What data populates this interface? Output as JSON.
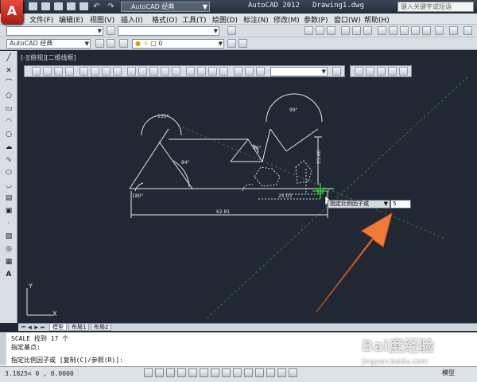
{
  "titlebar": {
    "logo": "A",
    "workspace": "AutoCAD 经典",
    "app_title": "AutoCAD 2012",
    "doc_title": "Drawing1.dwg",
    "search_placeholder": "键入关键字或短语"
  },
  "menu": [
    "文件(F)",
    "编辑(E)",
    "视图(V)",
    "插入(I)",
    "格式(O)",
    "工具(T)",
    "绘图(D)",
    "标注(N)",
    "修改(M)",
    "参数(P)",
    "窗口(W)",
    "帮助(H)"
  ],
  "toolbar2": {
    "workspace_combo": "AutoCAD 经典",
    "layer_combo": "0"
  },
  "viewport": {
    "label": "[-][俯视][二维线框]",
    "dimensions": {
      "angle_top_left": "135°",
      "angle_top_right": "99°",
      "angle_small": "40°",
      "angle_mid": "84°",
      "angle_bottom_left": "180°",
      "length_bottom": "62.81",
      "length_vertical": "25.46",
      "length_small": "25.03"
    },
    "axis_y": "Y",
    "axis_x": "X",
    "prompt_label": "指定比例因子或",
    "prompt_value": "5"
  },
  "tabs": [
    "模型",
    "布局1",
    "布局2"
  ],
  "command": {
    "line1": "SCALE 找到 17 个",
    "line2": "指定基点:",
    "line3": "指定比例因子或 [复制(C)/参照(R)]:"
  },
  "status": {
    "coords": "3.1825< 0 , 0.0000",
    "model": "模型"
  },
  "watermark": {
    "brand": "Bai度经验",
    "url": "jingyan.baidu.com"
  },
  "colors": {
    "canvas": "#212834",
    "drawing": "#e6e6e6",
    "guide_line": "#2f7d3a",
    "arrow": "#f07a3a"
  }
}
